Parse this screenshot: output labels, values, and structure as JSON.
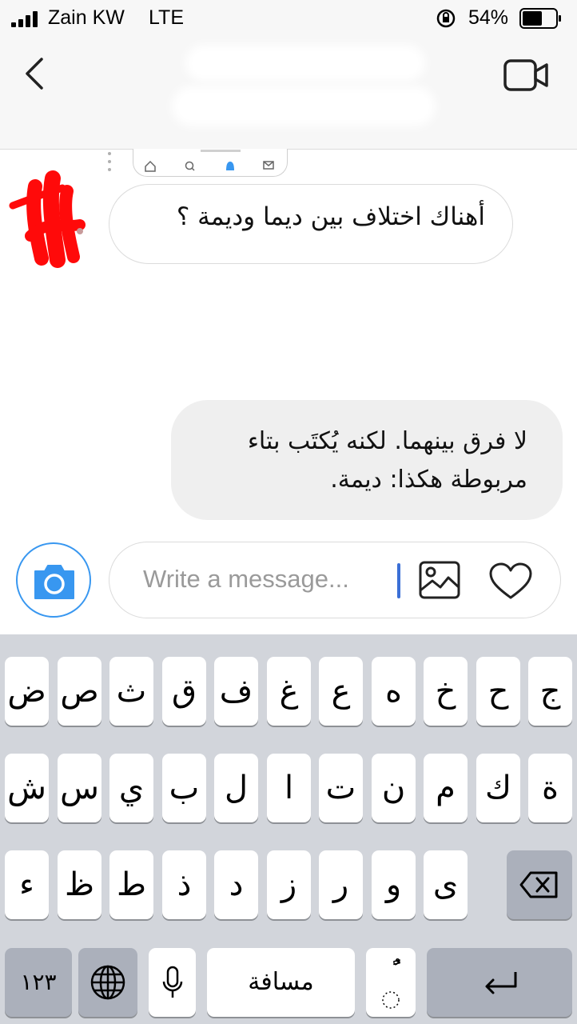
{
  "status_bar": {
    "carrier": "Zain KW",
    "network": "LTE",
    "battery_percent": "54%"
  },
  "header": {
    "back_icon": "chevron-left-icon",
    "video_icon": "video-camera-icon"
  },
  "messages": [
    {
      "from": "other",
      "text": "أهناك اختلاف بين ديما وديمة ؟"
    },
    {
      "from": "me",
      "text": "لا فرق بينهما. لكنه يُكتَب بتاء مربوطة هكذا: ديمة."
    }
  ],
  "composer": {
    "placeholder": "Write a message..."
  },
  "keyboard": {
    "row1": [
      "ج",
      "ح",
      "خ",
      "ه",
      "ع",
      "غ",
      "ف",
      "ق",
      "ث",
      "ص",
      "ض"
    ],
    "row2": [
      "ة",
      "ك",
      "م",
      "ن",
      "ت",
      "ا",
      "ل",
      "ب",
      "ي",
      "س",
      "ش"
    ],
    "row3": [
      "ى",
      "و",
      "ر",
      "ز",
      "د",
      "ذ",
      "ط",
      "ظ",
      "ء"
    ],
    "numbers_label": "١٢٣",
    "space_label": "مسافة",
    "diacritic_label": "ًٌ",
    "colors": {
      "background": "#d2d5db",
      "key": "#ffffff",
      "function_key": "#abb0bb"
    }
  },
  "colors": {
    "accent": "#3897f0",
    "bubble_out": "#efefef",
    "bubble_border": "#dbdbdb"
  }
}
